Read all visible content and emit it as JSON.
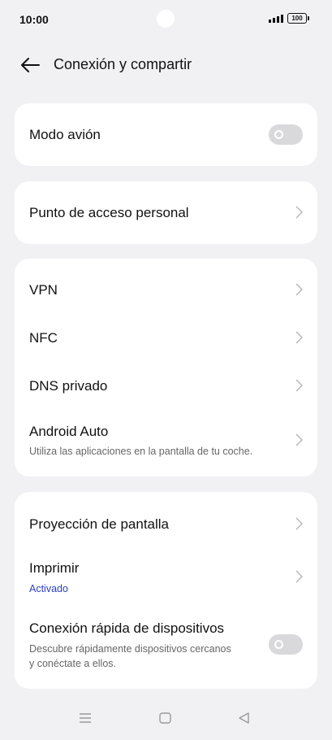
{
  "status": {
    "time": "10:00",
    "battery": "100"
  },
  "header": {
    "title": "Conexión y compartir"
  },
  "cards": {
    "airplane": {
      "title": "Modo avión"
    },
    "hotspot": {
      "title": "Punto de acceso personal"
    },
    "network": {
      "vpn": "VPN",
      "nfc": "NFC",
      "dns": "DNS privado",
      "android_auto": "Android Auto",
      "android_auto_sub": "Utiliza las aplicaciones en la pantalla de tu coche."
    },
    "devices": {
      "screencast": "Proyección de pantalla",
      "print": "Imprimir",
      "print_sub": "Activado",
      "quick_connect": "Conexión rápida de dispositivos",
      "quick_connect_sub_1": "Descubre rápidamente dispositivos cercanos",
      "quick_connect_sub_2": "y conéctate a ellos."
    }
  },
  "colors": {
    "background": "#f1f1f3",
    "card": "#ffffff",
    "accent": "#2a3fc6",
    "toggle_off": "#d9d9db"
  },
  "icons": [
    "back-arrow-icon",
    "chevron-right-icon",
    "menu-icon",
    "home-icon",
    "back-triangle-icon",
    "signal-icon",
    "battery-icon"
  ]
}
